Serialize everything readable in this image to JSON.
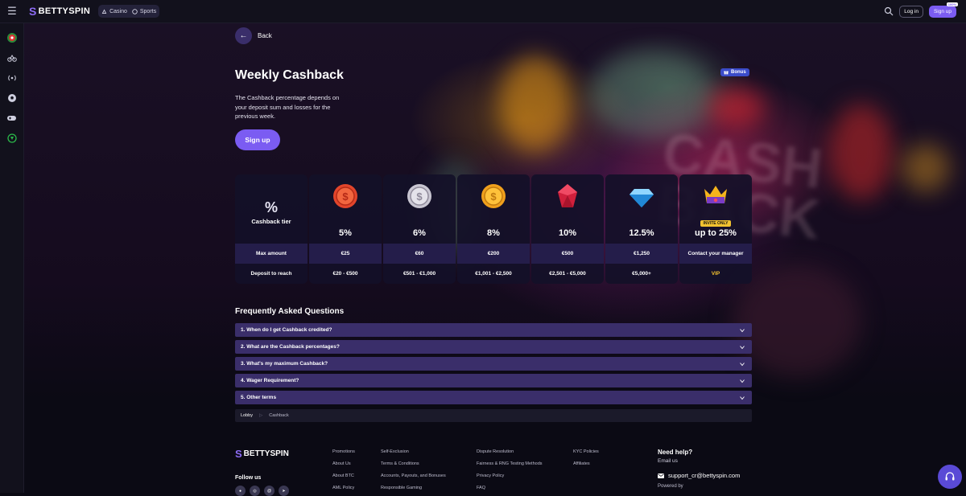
{
  "topbar": {
    "brand": "BETTYSPIN",
    "nav": [
      {
        "label": "Casino",
        "icon": "casino-icon"
      },
      {
        "label": "Sports",
        "icon": "football-icon"
      }
    ],
    "login_label": "Log in",
    "signup_label": "Sign up",
    "signup_tag": "100%"
  },
  "sidebar": {
    "icons": [
      "dartboard-icon",
      "bicycle-icon",
      "live-signal-icon",
      "football-icon",
      "gamepad-icon",
      "esports-icon"
    ]
  },
  "page": {
    "back_label": "Back",
    "title": "Weekly Cashback",
    "description": "The Cashback percentage depends on your deposit sum and losses for the previous week.",
    "signup_label": "Sign up",
    "bonus_badge": "Bonus"
  },
  "tiers": {
    "head": {
      "symbol": "%",
      "label": "Cashback tier",
      "row1": "Max amount",
      "row2": "Deposit to reach"
    },
    "items": [
      {
        "icon": "red-coin-icon",
        "percent": "5%",
        "max": "€25",
        "deposit": "€20 - €500"
      },
      {
        "icon": "silver-coin-icon",
        "percent": "6%",
        "max": "€60",
        "deposit": "€501 - €1,000"
      },
      {
        "icon": "gold-coin-icon",
        "percent": "8%",
        "max": "€200",
        "deposit": "€1,001 - €2,500"
      },
      {
        "icon": "ruby-icon",
        "percent": "10%",
        "max": "€500",
        "deposit": "€2,501 - €5,000"
      },
      {
        "icon": "diamond-icon",
        "percent": "12.5%",
        "max": "€1,250",
        "deposit": "€5,000+"
      },
      {
        "icon": "crown-icon",
        "percent": "up to 25%",
        "max": "Contact your manager",
        "deposit": "VIP",
        "tag": "INVITE ONLY"
      }
    ]
  },
  "faq": {
    "title": "Frequently Asked Questions",
    "items": [
      "1.  When do I get Cashback credited?",
      "2.  What are the Cashback percentages?",
      "3.  What's my maximum Cashback?",
      "4.  Wager Requirement?",
      "5.  Other terms"
    ]
  },
  "breadcrumb": {
    "root": "Lobby",
    "current": "Cashback"
  },
  "footer": {
    "brand": "BETTYSPIN",
    "follow_us": "Follow us",
    "col1": [
      "Promotions",
      "About Us",
      "About BTC",
      "AML Policy"
    ],
    "col2": [
      "Self-Exclusion",
      "Terms & Conditions",
      "Accounts, Payouts, and Bonuses",
      "Responsible Gaming"
    ],
    "col3": [
      "Dispute Resolution",
      "Fairness & RNG Testing Methods",
      "Privacy Policy",
      "FAQ"
    ],
    "col4": [
      "KYC Policies",
      "Affiliates"
    ],
    "help_title": "Need help?",
    "email_label": "Email us",
    "email": "support_cr@bettyspin.com",
    "powered": "Powered by"
  },
  "colors": {
    "accent": "#7b5cf2",
    "faq_bg": "#3a2e6a",
    "vip": "#f2c230"
  }
}
